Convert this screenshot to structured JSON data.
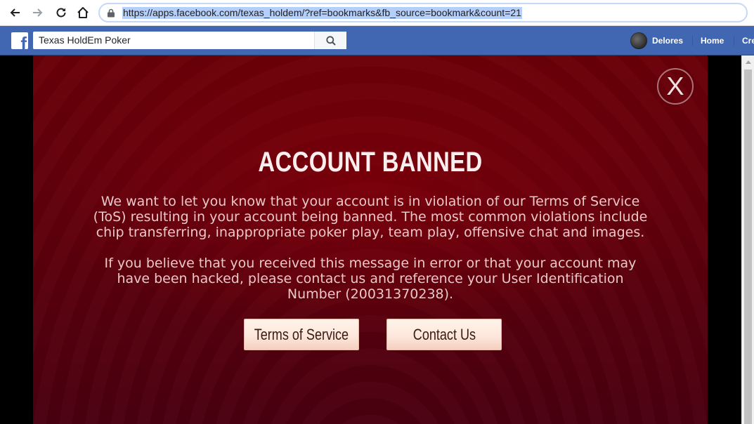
{
  "browser": {
    "url": "https://apps.facebook.com/texas_holdem/?ref=bookmarks&fb_source=bookmark&count=21"
  },
  "facebook": {
    "search_value": "Texas HoldEm Poker",
    "user_name": "Delores",
    "nav_home": "Home",
    "nav_create": "Cre"
  },
  "dialog": {
    "title": "ACCOUNT BANNED",
    "paragraph_1": "We want to let you know that your account is in violation of our Terms of Service (ToS) resulting in your account being banned. The most common violations include chip transferring, inappropriate poker play, team play, offensive chat and images.",
    "paragraph_2": "If you believe that you received this message in error or that your account may have been hacked, please contact us and reference your User Identification Number (20031370238).",
    "close_label": "X",
    "terms_button": "Terms of Service",
    "contact_button": "Contact Us"
  },
  "colors": {
    "facebook_blue": "#4267b2",
    "dialog_red": "#6a0008",
    "button_face": "#fde7dc"
  },
  "icons": {
    "back": "arrow-left-icon",
    "forward": "arrow-right-icon",
    "reload": "reload-icon",
    "home": "home-icon",
    "lock": "lock-icon",
    "search": "search-icon",
    "close": "close-icon",
    "facebook": "facebook-logo-icon"
  }
}
